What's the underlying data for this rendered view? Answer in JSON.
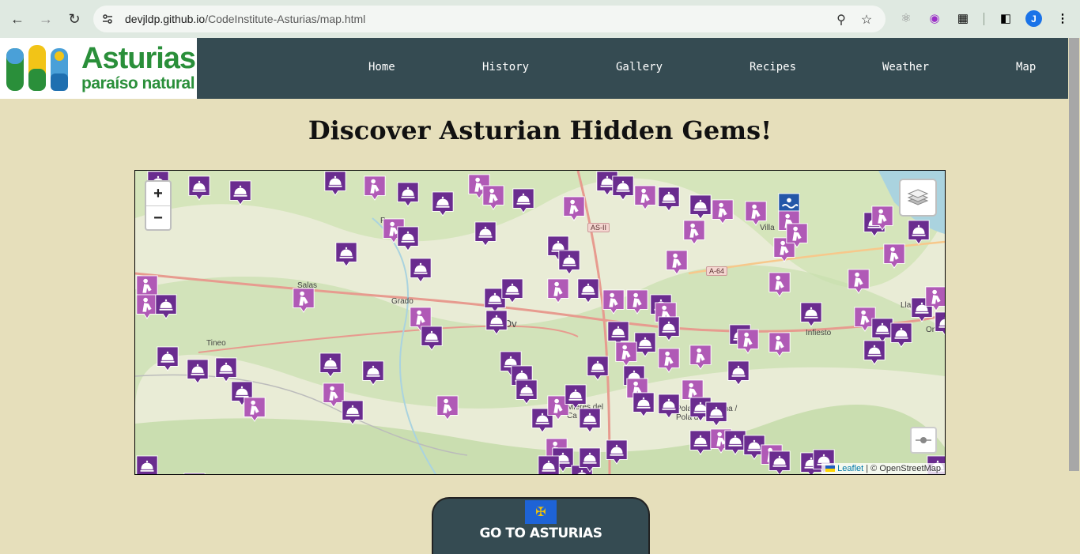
{
  "browser": {
    "url_host": "devjldp.github.io",
    "url_path": "/CodeInstitute-Asturias/map.html",
    "avatar_letter": "J"
  },
  "logo": {
    "title": "Asturias",
    "subtitle": "paraíso natural"
  },
  "nav": {
    "items": [
      {
        "label": "Home"
      },
      {
        "label": "History"
      },
      {
        "label": "Gallery"
      },
      {
        "label": "Recipes"
      },
      {
        "label": "Weather"
      },
      {
        "label": "Map"
      }
    ]
  },
  "page": {
    "title": "Discover Asturian Hidden Gems!"
  },
  "map": {
    "zoom_in": "+",
    "zoom_out": "−",
    "attribution_leaflet": "Leaflet",
    "attribution_osm": "| © OpenStreetMap",
    "road_labels": [
      "AS-II",
      "A-64"
    ],
    "place_labels": [
      "Villa",
      "Pr",
      "Salas",
      "Grado",
      "Ov",
      "Tineo",
      "Infiesto",
      "Mieres del Ca",
      "Pola de Laviana / Pola de",
      "Onís",
      "Llane",
      "que"
    ],
    "marker_colors": {
      "restaurant": "#6a2c8f",
      "sight": "#b05ab6",
      "beach": "#2457a8"
    }
  },
  "cta": {
    "label": "GO TO ASTURIAS"
  }
}
